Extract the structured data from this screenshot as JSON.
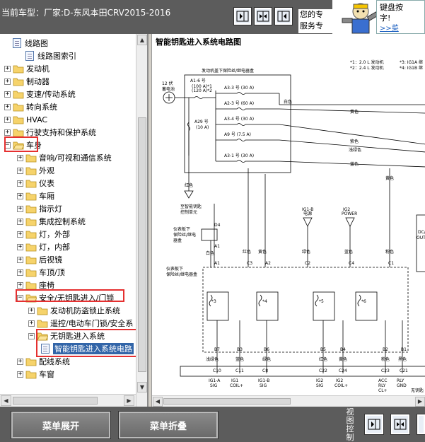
{
  "header": {
    "car_model": "当前车型：厂家:D-东风本田CRV2015-2016",
    "view_buttons": [
      {
        "name": "view-left-icon"
      },
      {
        "name": "view-split-icon"
      },
      {
        "name": "view-right-icon"
      }
    ]
  },
  "ad": {
    "left_text": "您的专\n服务专",
    "box_text": "键盘按\n字!",
    "link": ">>菜"
  },
  "tree": {
    "items": [
      {
        "label": "线路图",
        "type": "doc"
      },
      {
        "label": "线路图索引",
        "type": "doc"
      },
      {
        "label": "发动机",
        "type": "folder"
      },
      {
        "label": "制动器",
        "type": "folder"
      },
      {
        "label": "变速/传动系统",
        "type": "folder"
      },
      {
        "label": "转向系统",
        "type": "folder"
      },
      {
        "label": "HVAC",
        "type": "folder"
      },
      {
        "label": "行驶支持和保护系统",
        "type": "folder"
      },
      {
        "label": "车身",
        "type": "folder-open"
      },
      {
        "label": "音响/可视和通信系统",
        "type": "folder"
      },
      {
        "label": "外观",
        "type": "folder"
      },
      {
        "label": "仪表",
        "type": "folder"
      },
      {
        "label": "车厢",
        "type": "folder"
      },
      {
        "label": "指示灯",
        "type": "folder"
      },
      {
        "label": "集成控制系统",
        "type": "folder"
      },
      {
        "label": "灯，外部",
        "type": "folder"
      },
      {
        "label": "灯，内部",
        "type": "folder"
      },
      {
        "label": "后视镜",
        "type": "folder"
      },
      {
        "label": "车顶/顶",
        "type": "folder"
      },
      {
        "label": "座椅",
        "type": "folder"
      },
      {
        "label": "安全/无钥匙进入/门锁",
        "type": "folder-open"
      },
      {
        "label": "发动机防盗锁止系统",
        "type": "folder"
      },
      {
        "label": "遥控/电动车门锁/安全系",
        "type": "folder"
      },
      {
        "label": "无钥匙进入系统",
        "type": "folder-open"
      },
      {
        "label": "智能钥匙进入系统电路",
        "type": "doc-selected"
      },
      {
        "label": "配线系统",
        "type": "folder"
      },
      {
        "label": "车窗",
        "type": "folder"
      }
    ]
  },
  "diagram": {
    "title": "智能钥匙进入系统电路图",
    "fusebox_label": "发动机盖下保险丝/继电器盒",
    "battery_label": "12 伏\n蓄电池",
    "notes": [
      "*1：2.0 L 发动机",
      "*2：2.4 L 发动机",
      "*3: IG1A 继",
      "*4: IG1B 继"
    ],
    "fuses": [
      {
        "label": "A1-6 号\n(100 A)*1\n(120 A)*2"
      },
      {
        "label": "A3-3 号 (30 A)"
      },
      {
        "label": "A2-3 号 (60 A)"
      },
      {
        "label": "A3-4 号 (30 A)"
      },
      {
        "label": "A29 号\n(10 A)"
      },
      {
        "label": "A9 号 (7.5 A)"
      },
      {
        "label": "A3-1 号 (30 A)"
      }
    ],
    "wire_colors": [
      "白色",
      "黄色",
      "紫色",
      "浅绿色",
      "蓝色",
      "红色",
      "黑色",
      "绿色",
      "粉色"
    ],
    "ig_labels": [
      "IG1-B\n电源",
      "IG2\nPOWER"
    ],
    "relay_box_1": "仪表板下\n保险丝/继电\n器盒",
    "relay_box_2": "仪表板下\n保险丝/继电器盒",
    "connector_pins_top": [
      "D4",
      "A1",
      "C3",
      "A2",
      "C2",
      "C4",
      "C1"
    ],
    "relays": [
      "*3",
      "*4",
      "*5",
      "*6"
    ],
    "connector_pins_bottom": [
      "B7",
      "B3",
      "B6",
      "B5",
      "B4",
      "B2",
      "B1"
    ],
    "connector_pins_c": [
      "C10",
      "C11",
      "C8",
      "C22",
      "C24",
      "C23",
      "C21"
    ],
    "terminal_labels": [
      "IG1-A\nSIG",
      "IG1\nCOIL+",
      "IG1-B\nSIG",
      "IG2\nSIG",
      "IG2\nCOIL+",
      "ACC\nRLY\nCL+",
      "RLY\nGND"
    ],
    "right_labels": [
      "DC/\nOUT",
      "无钥匙"
    ],
    "left_label": "至智能钥匙\n控制单元"
  },
  "footer": {
    "expand_label": "菜单展开",
    "collapse_label": "菜单折叠",
    "view_label": "视图控制"
  }
}
